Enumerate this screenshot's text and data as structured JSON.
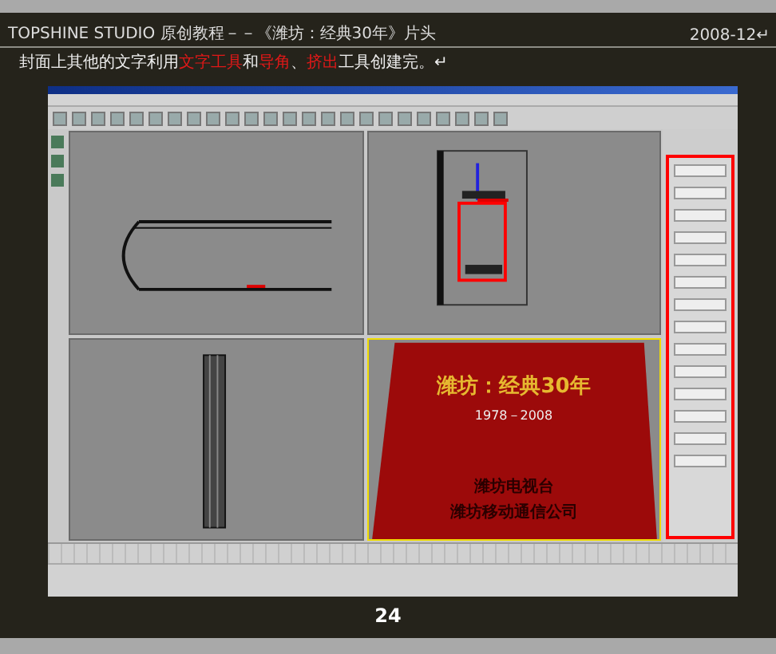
{
  "header": {
    "title": "TOPSHINE STUDIO 原创教程－－《潍坊：经典30年》片头",
    "date": "2008-12↵"
  },
  "instruction": [
    {
      "text": "封面上其他的文字利用",
      "highlight": false
    },
    {
      "text": "文字工具",
      "highlight": true
    },
    {
      "text": "和",
      "highlight": false
    },
    {
      "text": "导角",
      "highlight": true
    },
    {
      "text": "、",
      "highlight": false
    },
    {
      "text": "挤出",
      "highlight": true
    },
    {
      "text": "工具创建完。↵",
      "highlight": false
    }
  ],
  "screenshot": {
    "viewports": [
      {
        "kind": "top",
        "active": false
      },
      {
        "kind": "front",
        "active": false
      },
      {
        "kind": "left",
        "active": false
      },
      {
        "kind": "perspective",
        "active": true,
        "title": "潍坊：经典30年",
        "years": "1978－2008",
        "lines": [
          "潍坊电视台",
          "潍坊移动通信公司"
        ]
      }
    ]
  },
  "page_number": "24"
}
